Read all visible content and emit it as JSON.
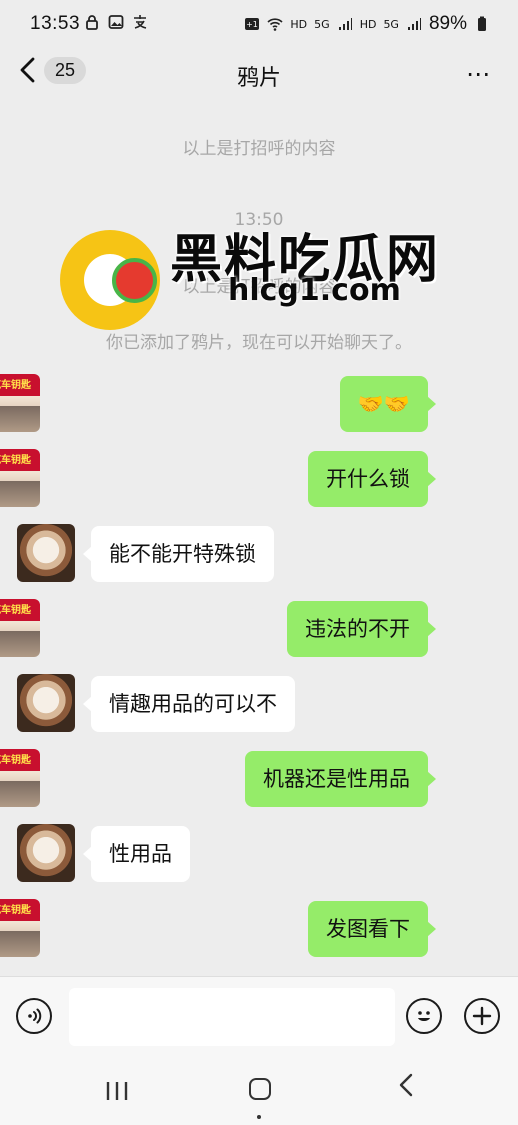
{
  "status_bar": {
    "time": "13:53",
    "net_icons": [
      "lock-icon",
      "gallery-icon",
      "alipay-icon"
    ],
    "hd1": "HD",
    "sig1": "5G",
    "hd2": "HD",
    "sig2": "5G",
    "battery": "89%"
  },
  "header": {
    "back_count": "25",
    "title": "鸦片",
    "more_label": "⋯"
  },
  "system_messages": {
    "greeting_top": "以上是打招呼的内容",
    "timestamp": "13:50",
    "greeting_bottom": "以上是打招呼的内容",
    "added_notice": "你已添加了鸦片，现在可以开始聊天了。"
  },
  "messages": [
    {
      "side": "me",
      "text": "🤝🤝"
    },
    {
      "side": "me",
      "text": "开什么锁"
    },
    {
      "side": "them",
      "text": "能不能开特殊锁"
    },
    {
      "side": "me",
      "text": "违法的不开"
    },
    {
      "side": "them",
      "text": "情趣用品的可以不"
    },
    {
      "side": "me",
      "text": "机器还是性用品"
    },
    {
      "side": "them",
      "text": "性用品"
    },
    {
      "side": "me",
      "text": "发图看下"
    }
  ],
  "shop_avatar_text": "汽车钥匙",
  "watermark": {
    "title": "黑料吃瓜网",
    "url": "hlcg1.com"
  },
  "colors": {
    "my_bubble": "#95ec69",
    "their_bubble": "#ffffff",
    "background": "#ededed"
  }
}
